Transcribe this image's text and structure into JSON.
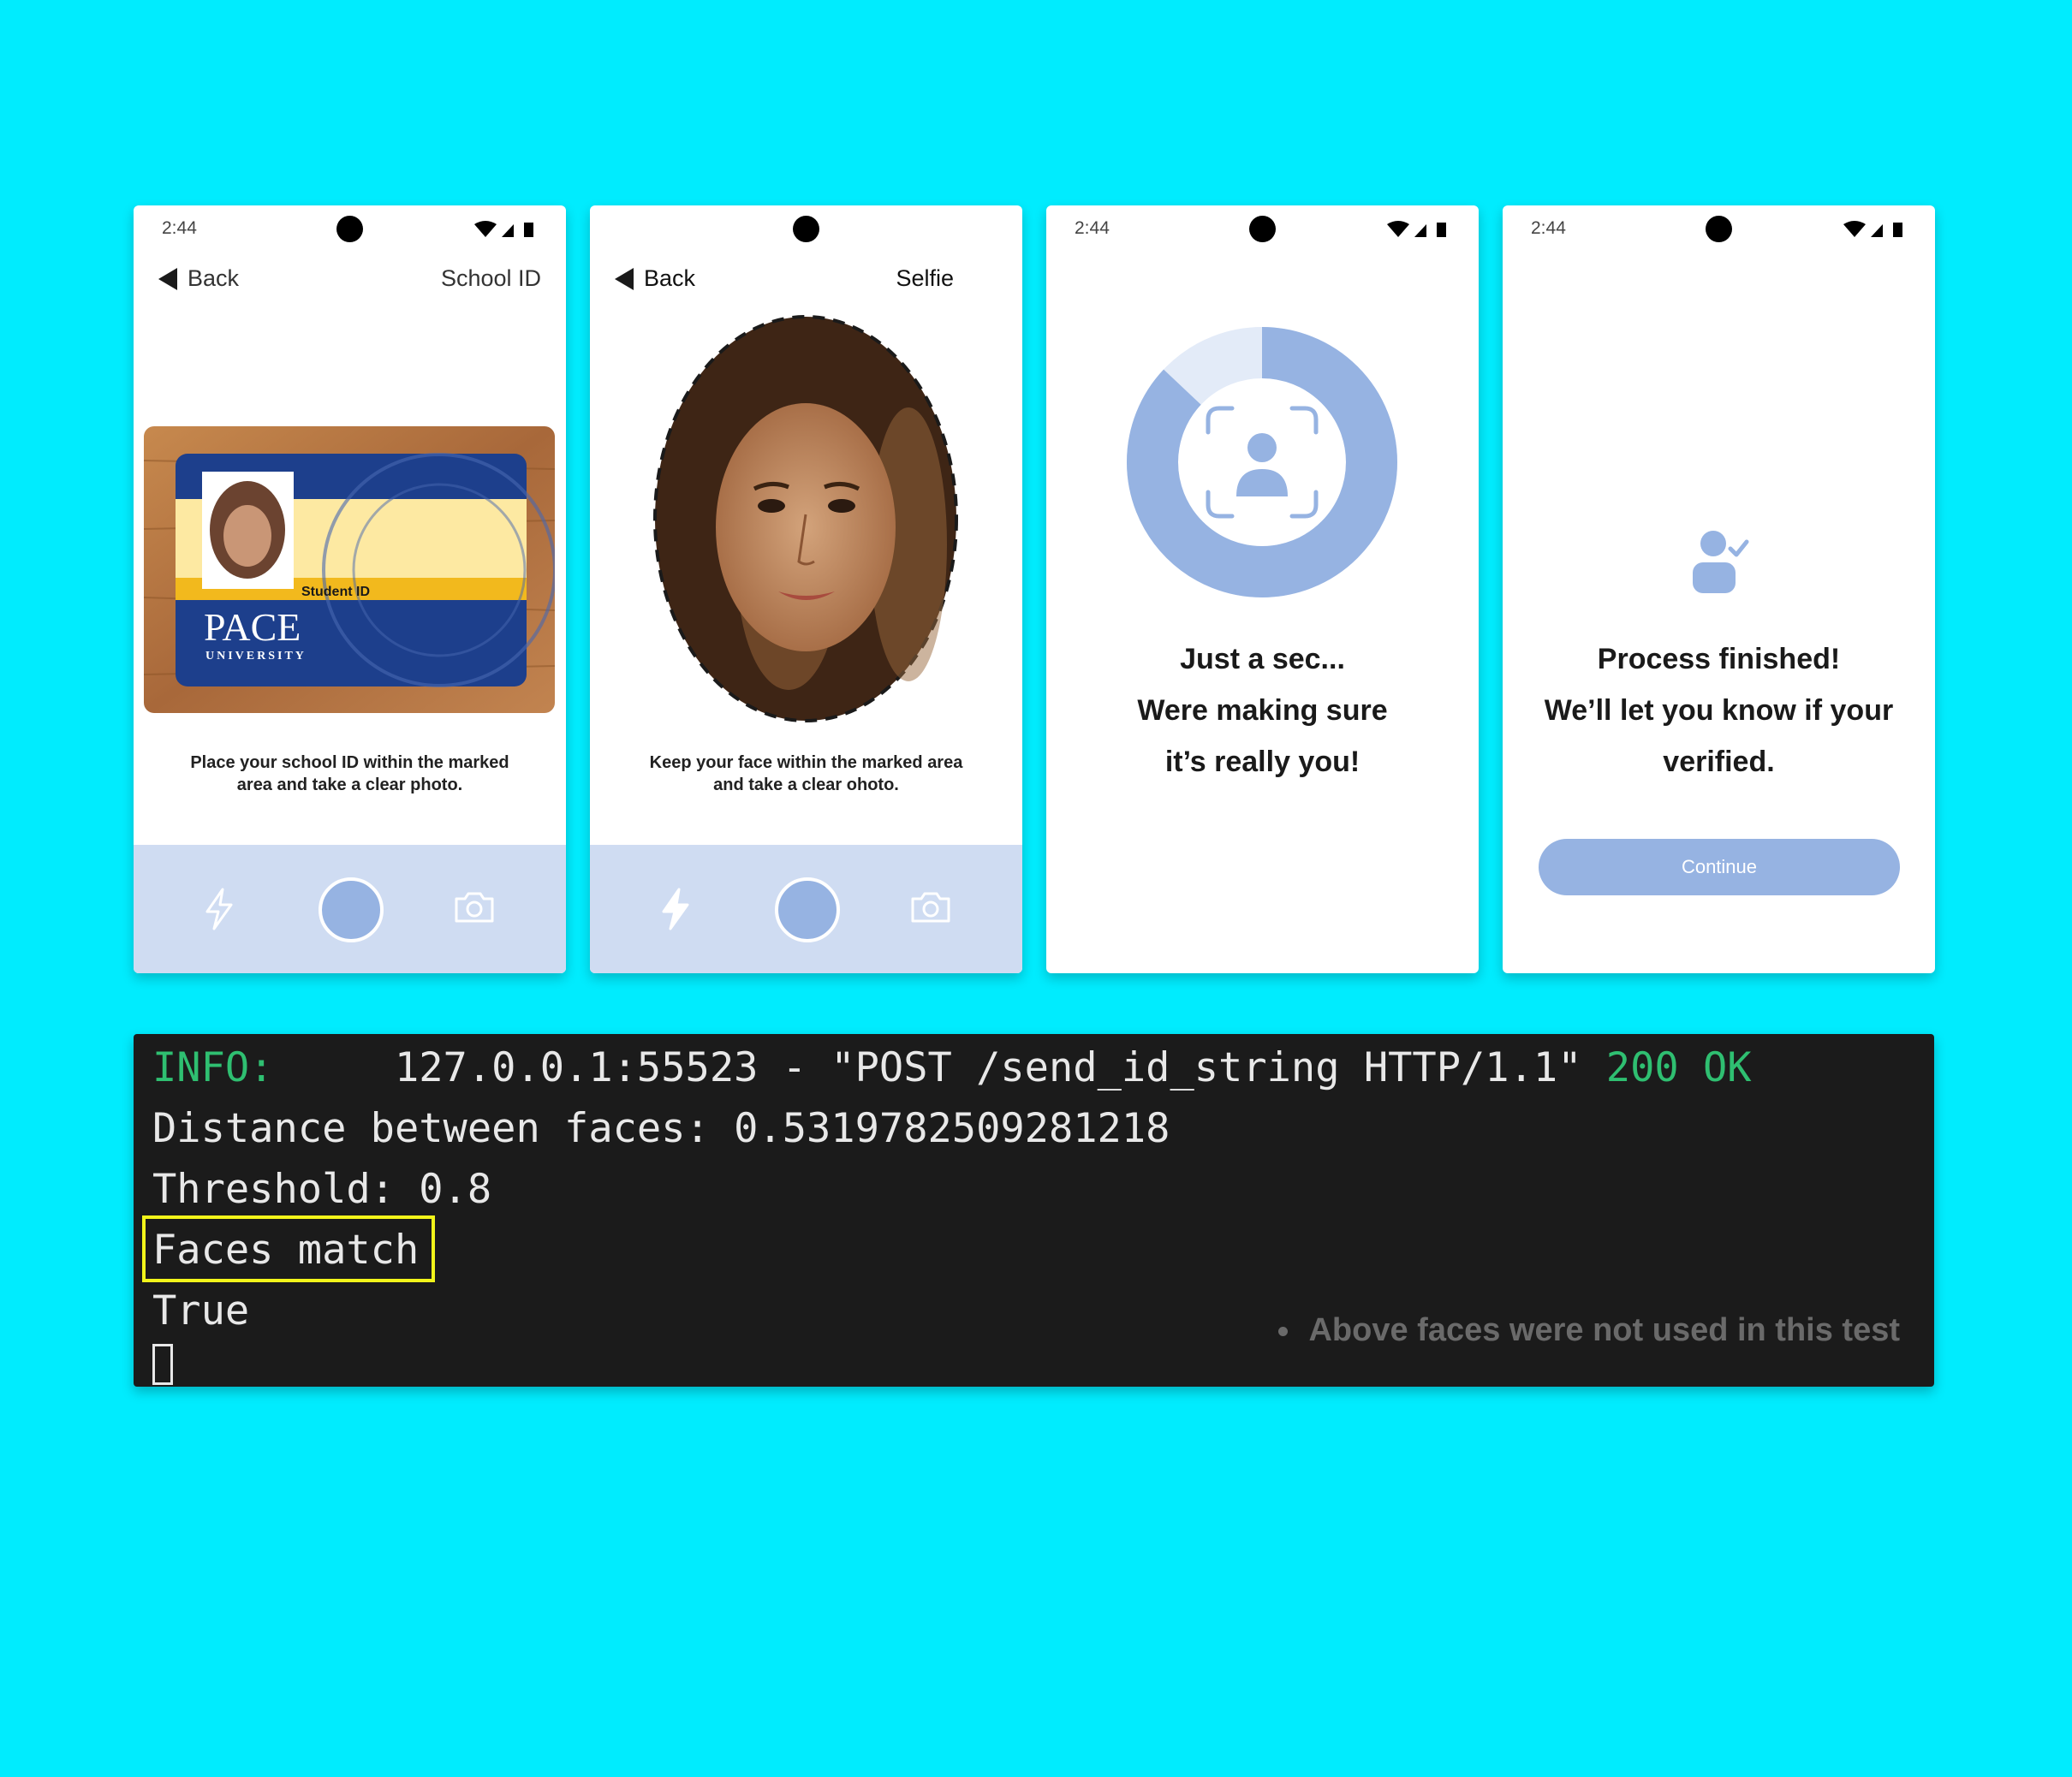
{
  "colors": {
    "background": "#00ecfe",
    "accent_blue": "#96b3e2",
    "camera_bar": "#cfdcf2",
    "terminal_bg": "#1b1b1b",
    "terminal_green": "#2fbf71",
    "highlight_yellow": "#f2f51a"
  },
  "phones": [
    {
      "time": "2:44",
      "back_label": "Back",
      "title": "School ID",
      "card": {
        "badge": "Student ID",
        "brand": "PACE",
        "brand_sub": "UNIVERSITY"
      },
      "instruction": [
        "Place your school ID within the marked",
        "area and take a clear photo."
      ]
    },
    {
      "back_label": "Back",
      "title": "Selfie",
      "instruction": [
        "Keep your face within the marked area",
        "and take a clear ohoto."
      ]
    },
    {
      "time": "2:44",
      "progress_fraction": 0.87,
      "message": [
        "Just a sec...",
        "Were making sure",
        "it’s really you!"
      ]
    },
    {
      "time": "2:44",
      "message": [
        "Process finished!",
        "We’ll let you know if your",
        "verified."
      ],
      "button_label": "Continue"
    }
  ],
  "terminal": {
    "line1_prefix": "INFO:",
    "line1_main": "127.0.0.1:55523 - \"POST /send_id_string HTTP/1.1\"",
    "line1_status": "200 OK",
    "line2": "Distance between faces: 0.5319782509281218",
    "line3": "Threshold: 0.8",
    "line4": "Faces match",
    "line5": "True",
    "note": "Above faces were not used in this test"
  }
}
